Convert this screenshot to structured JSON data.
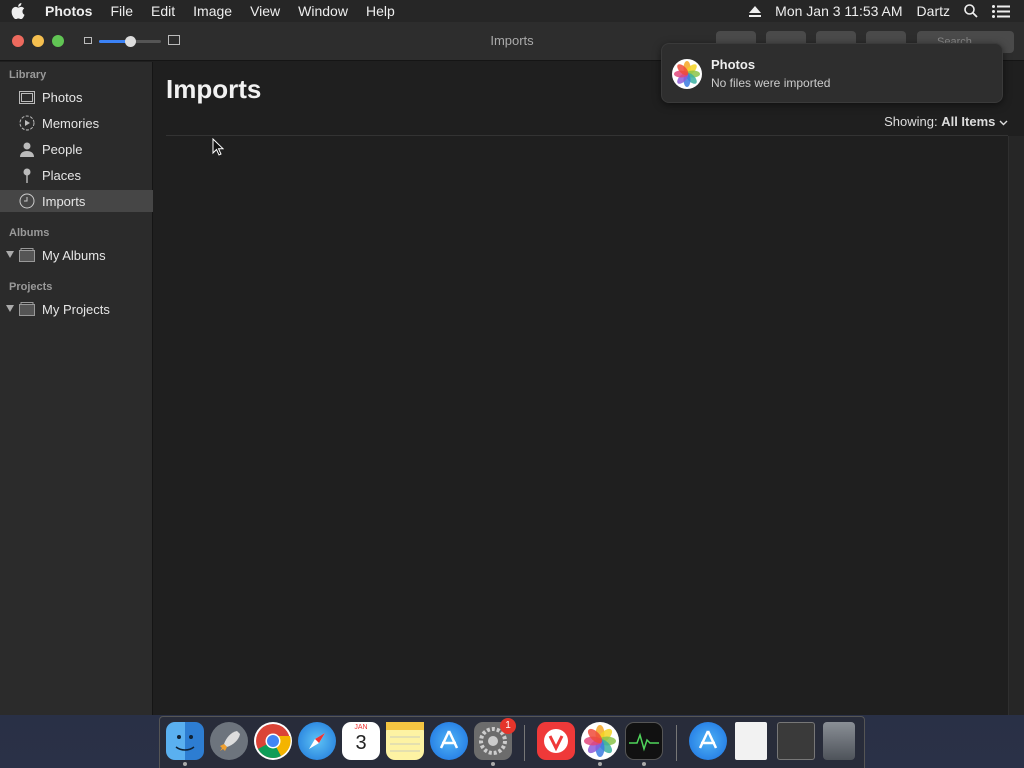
{
  "menubar": {
    "app_name": "Photos",
    "items": [
      "File",
      "Edit",
      "Image",
      "View",
      "Window",
      "Help"
    ],
    "clock": "Mon Jan 3  11:53 AM",
    "user": "Dartz"
  },
  "window": {
    "title": "Imports",
    "search_placeholder": "Search"
  },
  "sidebar": {
    "library_header": "Library",
    "library_items": [
      {
        "label": "Photos",
        "icon": "photos-icon"
      },
      {
        "label": "Memories",
        "icon": "memories-icon"
      },
      {
        "label": "People",
        "icon": "person-icon"
      },
      {
        "label": "Places",
        "icon": "pin-icon"
      },
      {
        "label": "Imports",
        "icon": "clock-icon",
        "selected": true
      }
    ],
    "albums_header": "Albums",
    "albums_item": "My Albums",
    "projects_header": "Projects",
    "projects_item": "My Projects"
  },
  "main": {
    "title": "Imports",
    "showing_label": "Showing:",
    "showing_value": "All Items"
  },
  "notification": {
    "app": "Photos",
    "message": "No files were imported"
  },
  "dock": {
    "apps": [
      "Finder",
      "Launchpad",
      "Chrome",
      "Safari",
      "Calendar",
      "Notes",
      "App Store",
      "System Preferences",
      "Vivaldi",
      "Photos",
      "Activity Monitor",
      "App Store Folder",
      "Document",
      "Screenshot",
      "Trash"
    ],
    "calendar_month": "JAN",
    "calendar_day": "3",
    "system_prefs_badge": "1"
  },
  "zoom_slider_value": 0.5
}
